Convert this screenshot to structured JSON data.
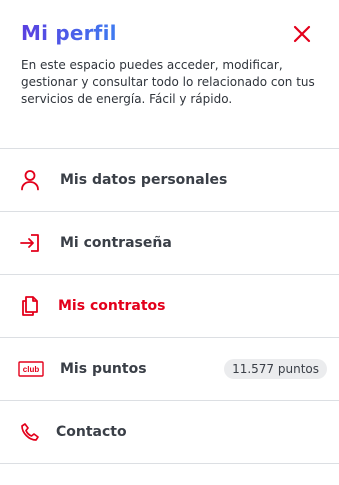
{
  "header": {
    "title": "Mi perfil",
    "description": "En este espacio puedes acceder, modificar, gestionar y consultar todo lo relacionado con tus servicios de energía. Fácil y rápido."
  },
  "menu": {
    "items": [
      {
        "label": "Mis datos personales",
        "icon": "user-icon"
      },
      {
        "label": "Mi contraseña",
        "icon": "login-arrow-icon"
      },
      {
        "label": "Mis contratos",
        "icon": "documents-icon",
        "active": true
      },
      {
        "label": "Mis puntos",
        "icon": "club-icon",
        "badge": "11.577 puntos",
        "icon_text": "club"
      },
      {
        "label": "Contacto",
        "icon": "phone-icon"
      }
    ]
  },
  "colors": {
    "accent": "#e3001b",
    "title_gradient_start": "#5a3fe0",
    "title_gradient_end": "#3e7bf0",
    "divider": "#dcdfe3",
    "badge_bg": "#ebecee"
  }
}
